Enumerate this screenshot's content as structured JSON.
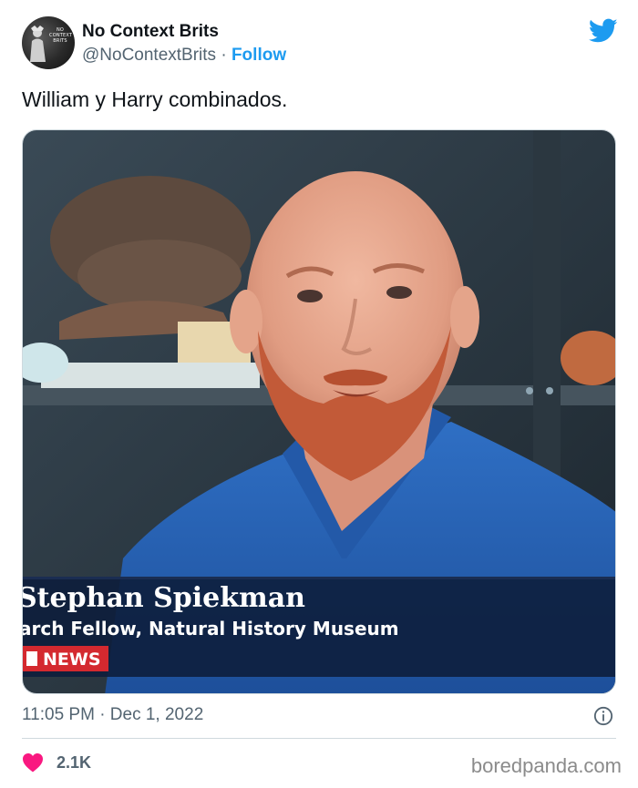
{
  "account": {
    "name": "No Context Brits",
    "handle": "@NoContextBrits",
    "separator": "·",
    "follow_label": "Follow",
    "avatar_text": "NO CONTEXT BRITS"
  },
  "tweet": {
    "text": "William y Harry combinados.",
    "timestamp": "11:05 PM · Dec 1, 2022",
    "likes": "2.1K"
  },
  "media": {
    "caption_name": "Stephan Spiekman",
    "caption_title": "arch Fellow, Natural History Museum",
    "badge": "NEWS"
  },
  "icons": {
    "brand": "twitter-bird-icon",
    "info": "info-icon",
    "like": "heart-icon"
  },
  "colors": {
    "accent": "#1d9bf0",
    "heart": "#f91880",
    "secondary_text": "#536471",
    "border": "#cfd9de"
  },
  "watermark": "boredpanda.com"
}
